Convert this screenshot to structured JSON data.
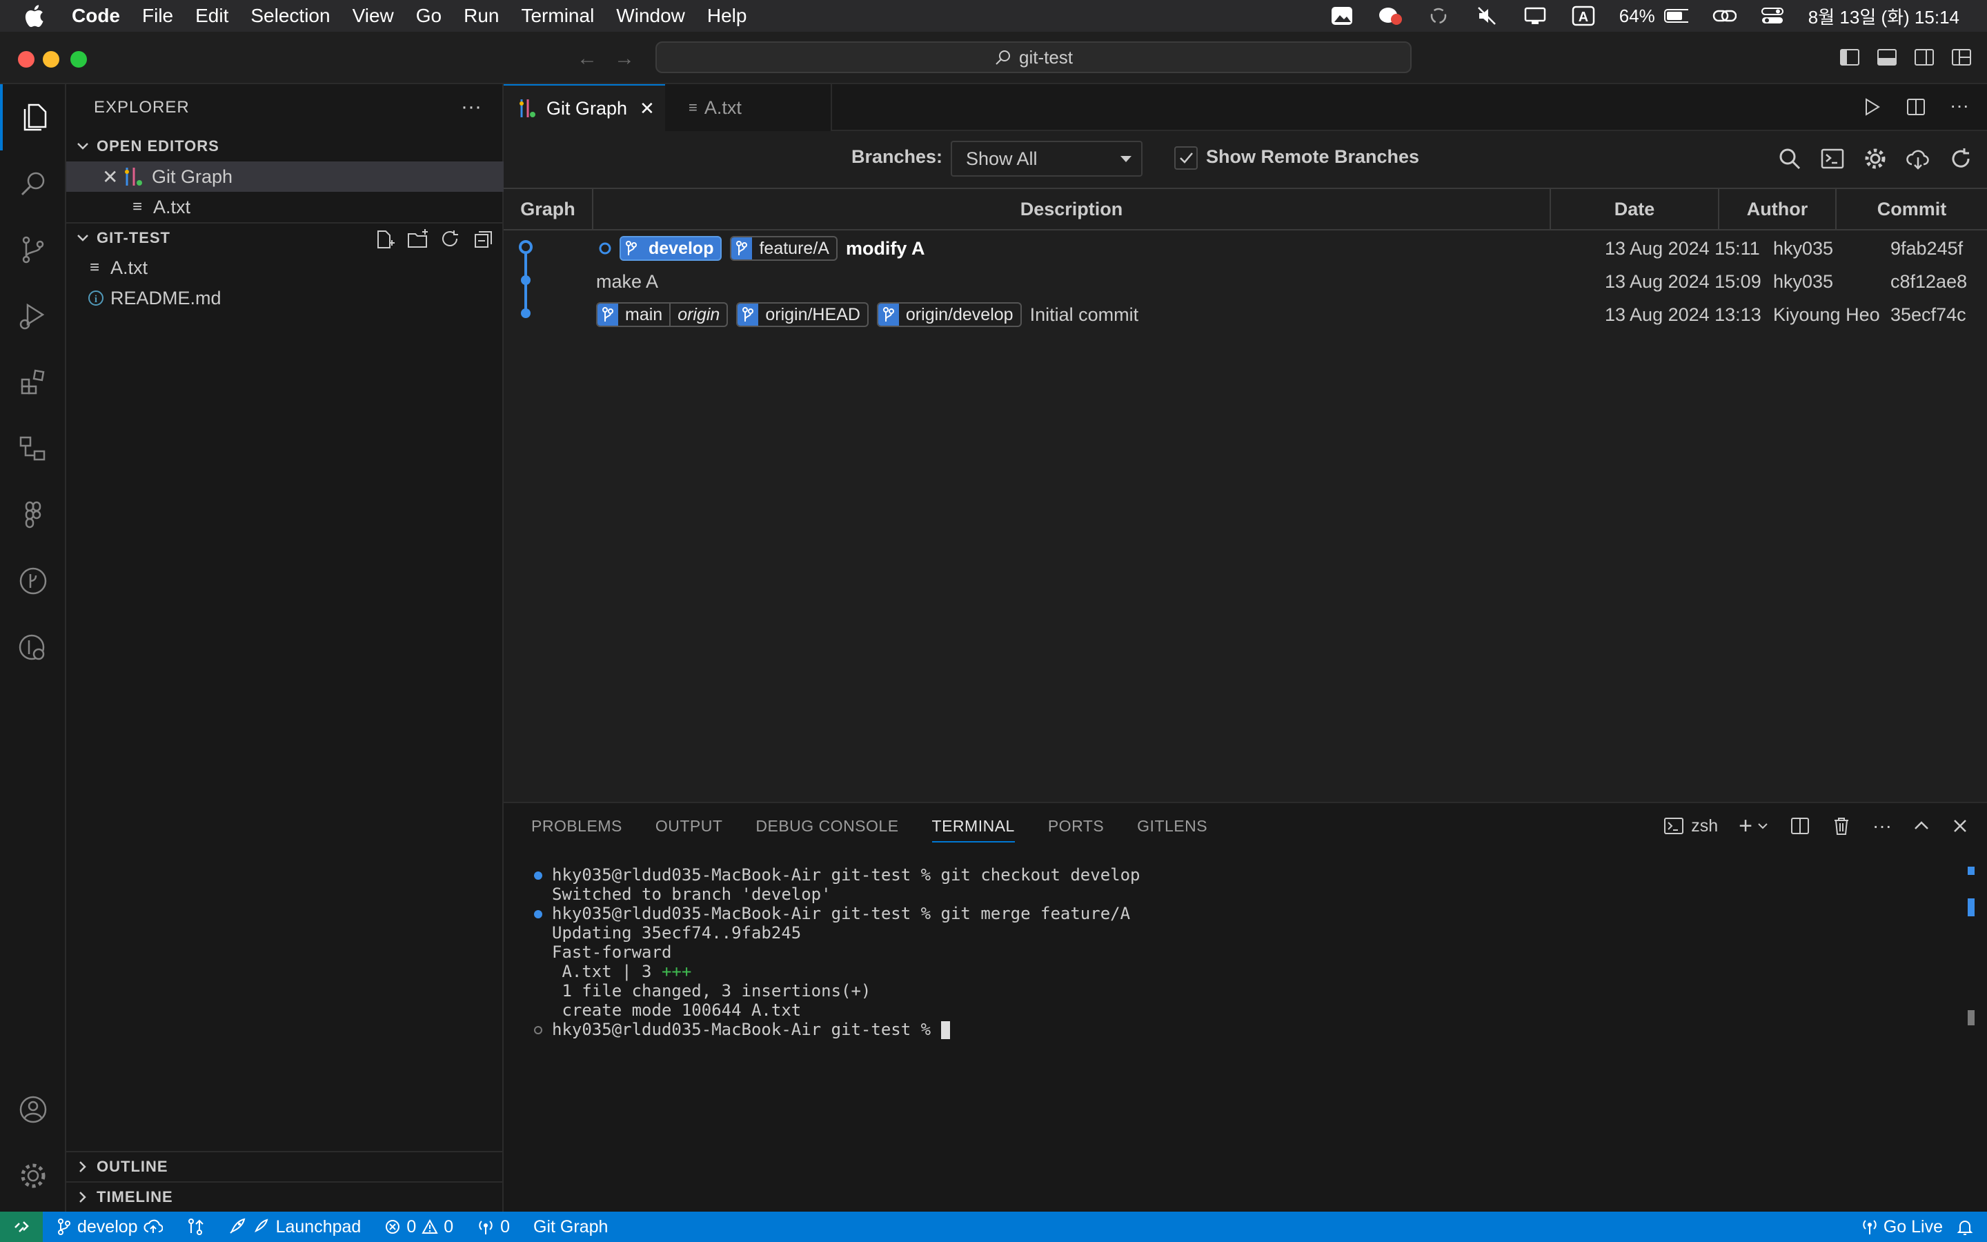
{
  "menubar": {
    "app": "Code",
    "items": [
      "File",
      "Edit",
      "Selection",
      "View",
      "Go",
      "Run",
      "Terminal",
      "Window",
      "Help"
    ],
    "battery": "64%",
    "clock": "8월 13일 (화) 15:14",
    "input_indicator": "A"
  },
  "titlebar": {
    "command_center": "git-test"
  },
  "sidebar": {
    "title": "EXPLORER",
    "open_editors": {
      "label": "OPEN EDITORS",
      "items": [
        "Git Graph",
        "A.txt"
      ]
    },
    "workspace": {
      "label": "GIT-TEST",
      "items": [
        "A.txt",
        "README.md"
      ]
    },
    "outline": "OUTLINE",
    "timeline": "TIMELINE"
  },
  "tabs": [
    {
      "label": "Git Graph",
      "active": true
    },
    {
      "label": "A.txt",
      "active": false
    }
  ],
  "git_graph": {
    "branches_label": "Branches:",
    "branches_value": "Show All",
    "remote_label": "Show Remote Branches",
    "columns": [
      "Graph",
      "Description",
      "Date",
      "Author",
      "Commit"
    ],
    "commits": [
      {
        "refs": [
          {
            "name": "develop",
            "head": true
          },
          {
            "name": "feature/A"
          }
        ],
        "message": "modify A",
        "date": "13 Aug 2024 15:11",
        "author": "hky035",
        "hash": "9fab245f"
      },
      {
        "refs": [],
        "message": "make A",
        "date": "13 Aug 2024 15:09",
        "author": "hky035",
        "hash": "c8f12ae8"
      },
      {
        "refs": [
          {
            "name": "main",
            "remote": "origin"
          },
          {
            "name": "origin/HEAD"
          },
          {
            "name": "origin/develop"
          }
        ],
        "message": "Initial commit",
        "date": "13 Aug 2024 13:13",
        "author": "Kiyoung Heo",
        "hash": "35ecf74c"
      }
    ]
  },
  "panel": {
    "tabs": [
      "PROBLEMS",
      "OUTPUT",
      "DEBUG CONSOLE",
      "TERMINAL",
      "PORTS",
      "GITLENS"
    ],
    "active_tab": "TERMINAL",
    "shell": "zsh",
    "lines": [
      {
        "dot": "blue",
        "text": "hky035@rldud035-MacBook-Air git-test % git checkout develop"
      },
      {
        "dot": "",
        "text": "Switched to branch 'develop'"
      },
      {
        "dot": "blue",
        "text": "hky035@rldud035-MacBook-Air git-test % git merge feature/A"
      },
      {
        "dot": "",
        "text": "Updating 35ecf74..9fab245"
      },
      {
        "dot": "",
        "text": "Fast-forward"
      },
      {
        "dot": "",
        "text": " A.txt | 3 ",
        "plus": "+++"
      },
      {
        "dot": "",
        "text": " 1 file changed, 3 insertions(+)"
      },
      {
        "dot": "",
        "text": " create mode 100644 A.txt"
      },
      {
        "dot": "empty",
        "text": "hky035@rldud035-MacBook-Air git-test % ",
        "cursor": true
      }
    ]
  },
  "statusbar": {
    "branch": "develop",
    "launchpad": "Launchpad",
    "errors": "0",
    "warnings": "0",
    "ports": "0",
    "git_graph": "Git Graph",
    "go_live": "Go Live"
  },
  "colors": {
    "accent": "#0078d4",
    "ref_blue": "#3a7bd5",
    "status": "#0078d4"
  }
}
